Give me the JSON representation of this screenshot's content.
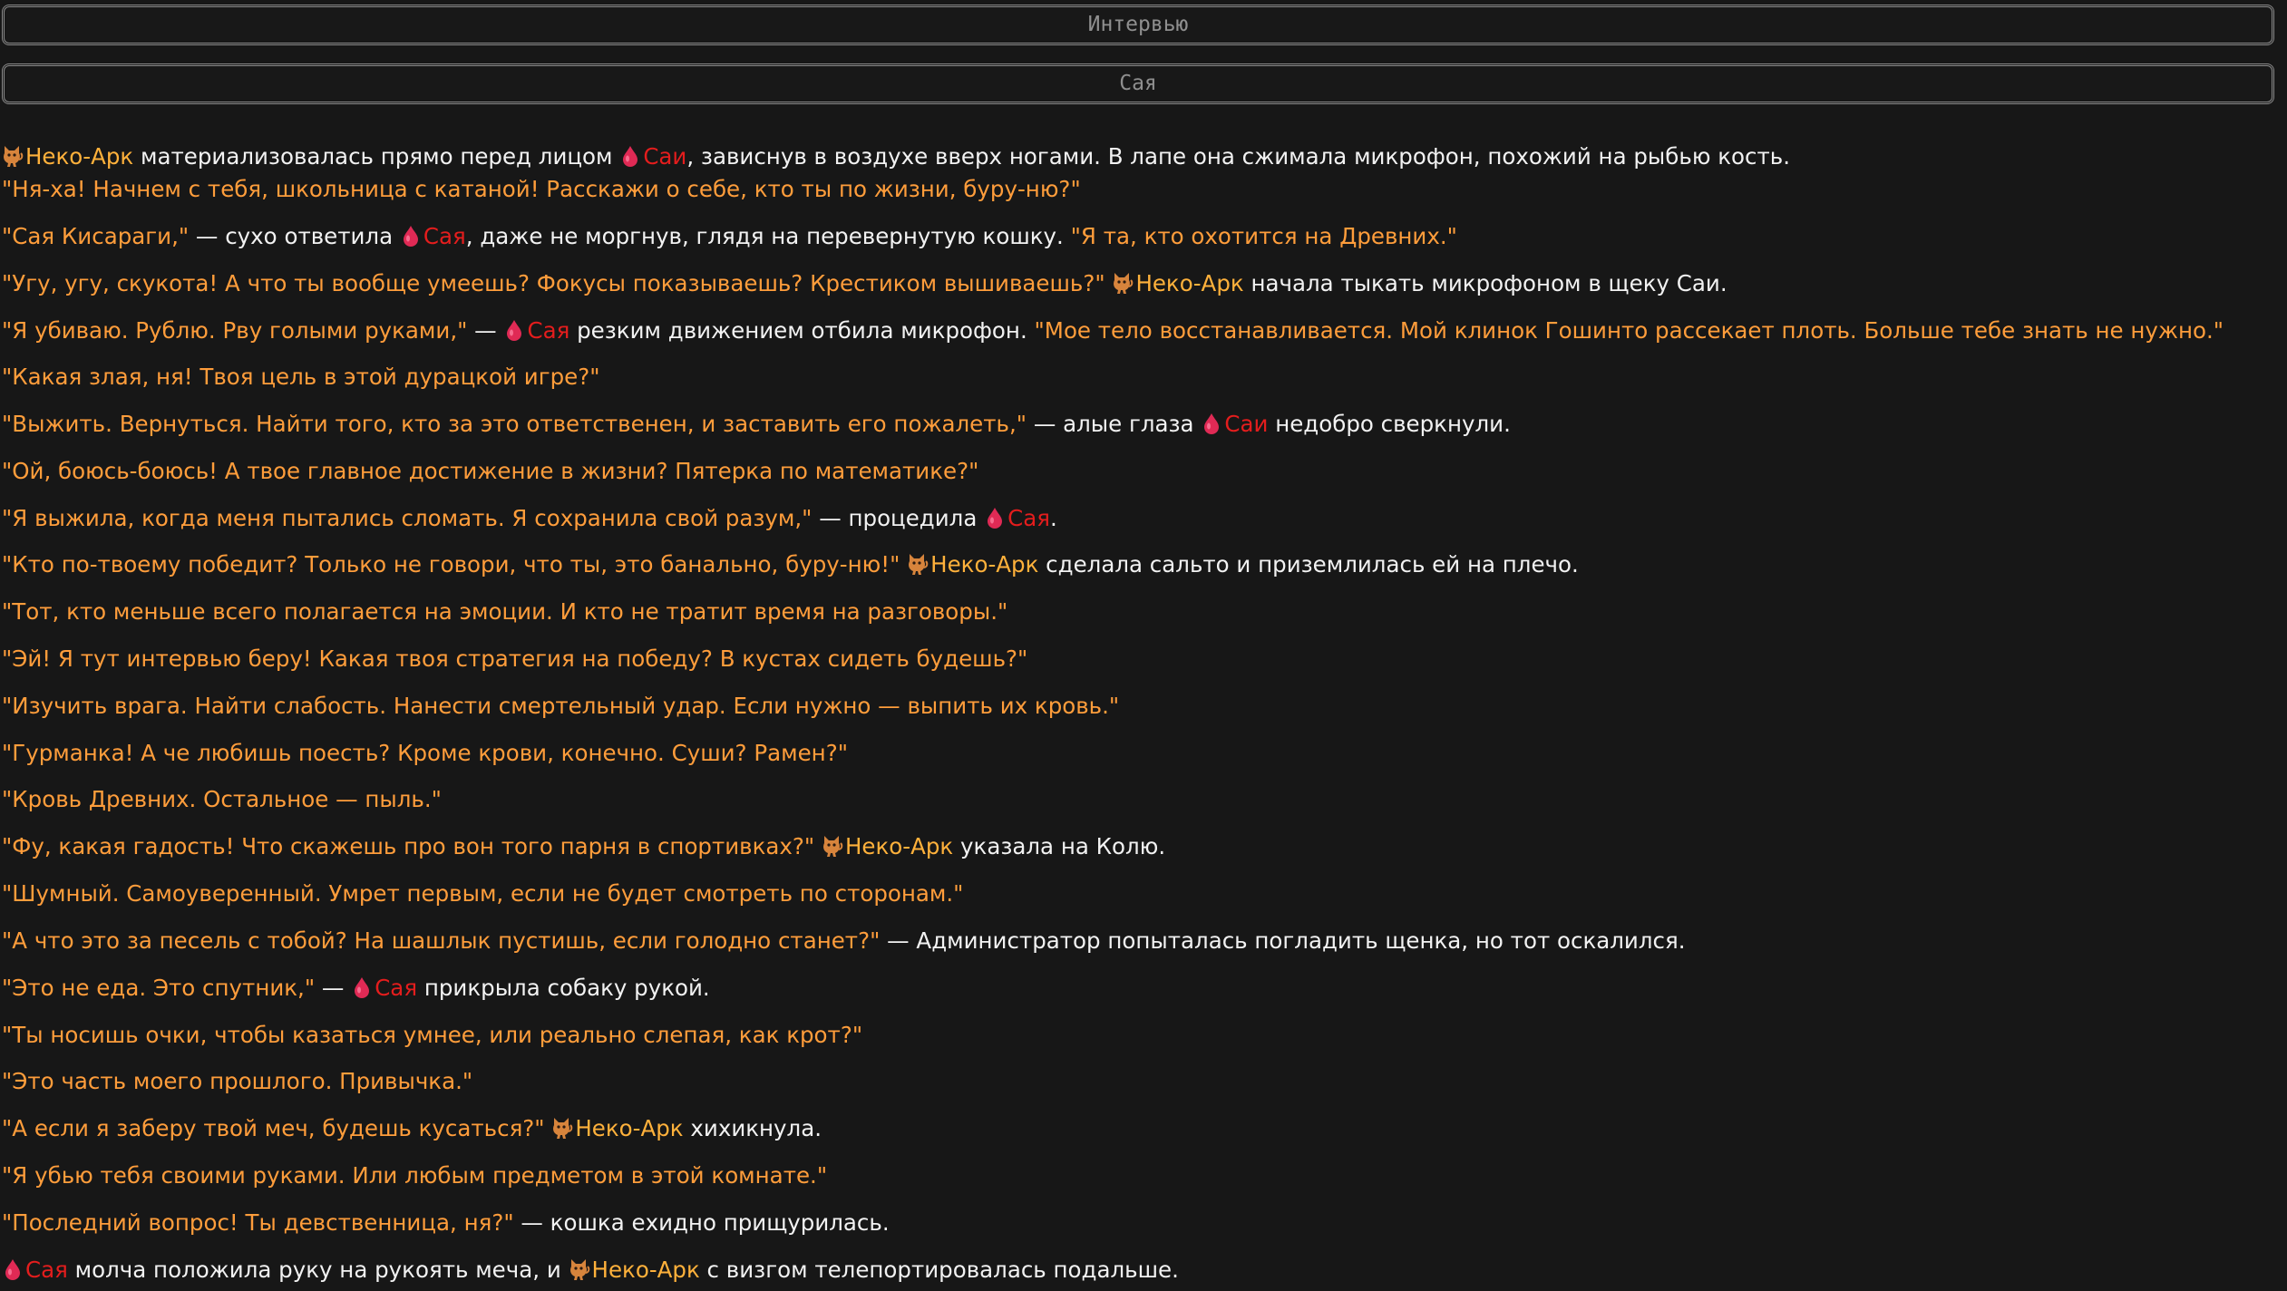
{
  "header": {
    "title": "Интервью",
    "subtitle": "Сая"
  },
  "colors": {
    "background": "#171717",
    "quote": "#ff9d3b",
    "narration": "#f2f2f2",
    "neko_name": "#ffb13b",
    "saya_name": "#e41d1d",
    "header_border": "#8a8a8a",
    "header_text": "#8f8f8f"
  },
  "icons": {
    "neko": "cat-icon",
    "saya": "blood-drop-icon"
  },
  "lines": [
    [
      [
        "icon",
        "neko"
      ],
      [
        "nk",
        "Неко-Арк"
      ],
      [
        "t",
        " материализовалась прямо перед лицом "
      ],
      [
        "icon",
        "saya"
      ],
      [
        "sy",
        "Саи"
      ],
      [
        "t",
        ", зависнув в воздухе вверх ногами. В лапе она сжимала микрофон, похожий на рыбью кость."
      ]
    ],
    [
      [
        "q",
        "\"Ня-ха! Начнем с тебя, школьница с катаной! Расскажи о себе, кто ты по жизни, буру-ню?\""
      ]
    ],
    [
      [
        "q",
        "\"Сая Кисараги,\""
      ],
      [
        "t",
        " — сухо ответила "
      ],
      [
        "icon",
        "saya"
      ],
      [
        "sy",
        "Сая"
      ],
      [
        "t",
        ", даже не моргнув, глядя на перевернутую кошку. "
      ],
      [
        "q",
        "\"Я та, кто охотится на Древних.\""
      ]
    ],
    [
      [
        "q",
        "\"Угу, угу, скукота! А что ты вообще умеешь? Фокусы показываешь? Крестиком вышиваешь?\""
      ],
      [
        "t",
        " "
      ],
      [
        "icon",
        "neko"
      ],
      [
        "nk",
        "Неко-Арк"
      ],
      [
        "t",
        " начала тыкать микрофоном в щеку Саи."
      ]
    ],
    [
      [
        "q",
        "\"Я убиваю. Рублю. Рву голыми руками,\""
      ],
      [
        "t",
        " — "
      ],
      [
        "icon",
        "saya"
      ],
      [
        "sy",
        "Сая"
      ],
      [
        "t",
        " резким движением отбила микрофон. "
      ],
      [
        "q",
        "\"Мое тело восстанавливается. Мой клинок Гошинто рассекает плоть. Больше тебе знать не нужно.\""
      ]
    ],
    [
      [
        "q",
        "\"Какая злая, ня! Твоя цель в этой дурацкой игре?\""
      ]
    ],
    [
      [
        "q",
        "\"Выжить. Вернуться. Найти того, кто за это ответственен, и заставить его пожалеть,\""
      ],
      [
        "t",
        " — алые глаза "
      ],
      [
        "icon",
        "saya"
      ],
      [
        "sy",
        "Саи"
      ],
      [
        "t",
        " недобро сверкнули."
      ]
    ],
    [
      [
        "q",
        "\"Ой, боюсь-боюсь! А твое главное достижение в жизни? Пятерка по математике?\""
      ]
    ],
    [
      [
        "q",
        "\"Я выжила, когда меня пытались сломать. Я сохранила свой разум,\""
      ],
      [
        "t",
        " — процедила "
      ],
      [
        "icon",
        "saya"
      ],
      [
        "sy",
        "Сая"
      ],
      [
        "t",
        "."
      ]
    ],
    [
      [
        "q",
        "\"Кто по-твоему победит? Только не говори, что ты, это банально, буру-ню!\""
      ],
      [
        "t",
        " "
      ],
      [
        "icon",
        "neko"
      ],
      [
        "nk",
        "Неко-Арк"
      ],
      [
        "t",
        " сделала сальто и приземлилась ей на плечо."
      ]
    ],
    [
      [
        "q",
        "\"Тот, кто меньше всего полагается на эмоции. И кто не тратит время на разговоры.\""
      ]
    ],
    [
      [
        "q",
        "\"Эй! Я тут интервью беру! Какая твоя стратегия на победу? В кустах сидеть будешь?\""
      ]
    ],
    [
      [
        "q",
        "\"Изучить врага. Найти слабость. Нанести смертельный удар. Если нужно — выпить их кровь.\""
      ]
    ],
    [
      [
        "q",
        "\"Гурманка! А че любишь поесть? Кроме крови, конечно. Суши? Рамен?\""
      ]
    ],
    [
      [
        "q",
        "\"Кровь Древних. Остальное — пыль.\""
      ]
    ],
    [
      [
        "q",
        "\"Фу, какая гадость! Что скажешь про вон того парня в спортивках?\""
      ],
      [
        "t",
        " "
      ],
      [
        "icon",
        "neko"
      ],
      [
        "nk",
        "Неко-Арк"
      ],
      [
        "t",
        " указала на Колю."
      ]
    ],
    [
      [
        "q",
        "\"Шумный. Самоуверенный. Умрет первым, если не будет смотреть по сторонам.\""
      ]
    ],
    [
      [
        "q",
        "\"А что это за песель с тобой? На шашлык пустишь, если голодно станет?\""
      ],
      [
        "t",
        " — Администратор попыталась погладить щенка, но тот оскалился."
      ]
    ],
    [
      [
        "q",
        "\"Это не еда. Это спутник,\""
      ],
      [
        "t",
        " — "
      ],
      [
        "icon",
        "saya"
      ],
      [
        "sy",
        "Сая"
      ],
      [
        "t",
        " прикрыла собаку рукой."
      ]
    ],
    [
      [
        "q",
        "\"Ты носишь очки, чтобы казаться умнее, или реально слепая, как крот?\""
      ]
    ],
    [
      [
        "q",
        "\"Это часть моего прошлого. Привычка.\""
      ]
    ],
    [
      [
        "q",
        "\"А если я заберу твой меч, будешь кусаться?\""
      ],
      [
        "t",
        " "
      ],
      [
        "icon",
        "neko"
      ],
      [
        "nk",
        "Неко-Арк"
      ],
      [
        "t",
        " хихикнула."
      ]
    ],
    [
      [
        "q",
        "\"Я убью тебя своими руками. Или любым предметом в этой комнате.\""
      ]
    ],
    [
      [
        "q",
        "\"Последний вопрос! Ты девственница, ня?\""
      ],
      [
        "t",
        " — кошка ехидно прищурилась."
      ]
    ],
    [
      [
        "icon",
        "saya"
      ],
      [
        "sy",
        "Сая"
      ],
      [
        "t",
        " молча положила руку на рукоять меча, и "
      ],
      [
        "icon",
        "neko"
      ],
      [
        "nk",
        "Неко-Арк"
      ],
      [
        "t",
        " с визгом телепортировалась подальше."
      ]
    ]
  ]
}
